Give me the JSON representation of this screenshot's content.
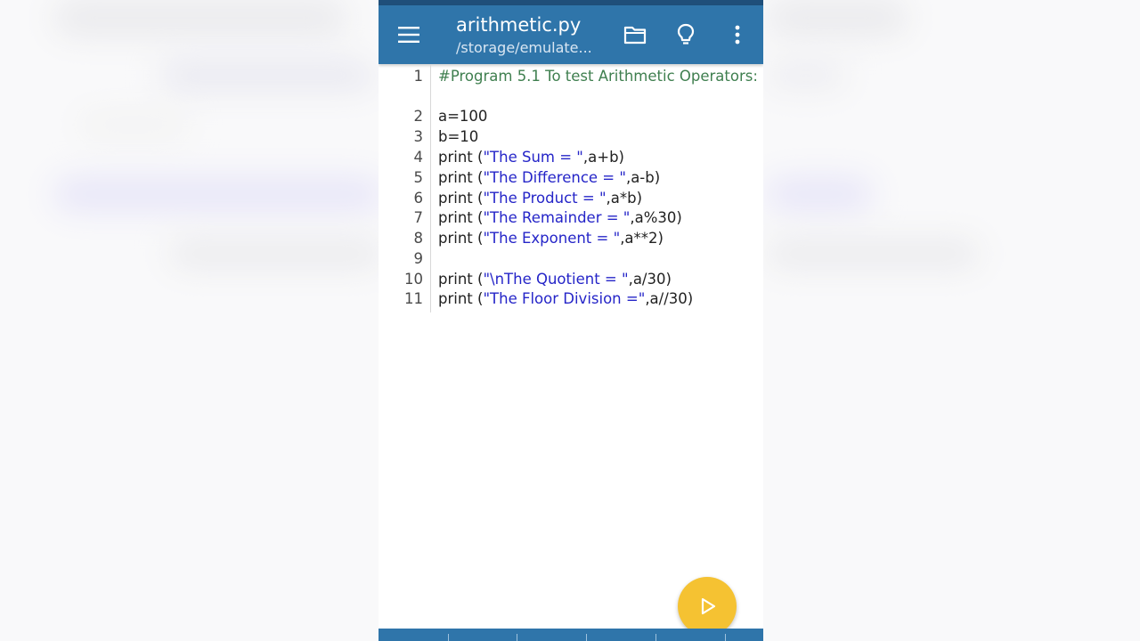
{
  "header": {
    "title": "arithmetic.py",
    "subtitle": "/storage/emulate..."
  },
  "icons": {
    "menu": "menu-icon",
    "folder": "folder-icon",
    "bulb": "lightbulb-icon",
    "more": "more-vert-icon",
    "run": "play-icon"
  },
  "colors": {
    "appbar": "#2f75aa",
    "comment": "#3f7f4f",
    "string": "#2525c8",
    "fab": "#f5c232"
  },
  "editor": {
    "lines": [
      {
        "num": "1",
        "parts": [
          {
            "text": "#Program 5.1 To test Arithmetic Operators:",
            "cls": "comment"
          }
        ]
      },
      {
        "num": "2",
        "parts": [
          {
            "text": "a=100",
            "cls": ""
          }
        ]
      },
      {
        "num": "3",
        "parts": [
          {
            "text": "b=10",
            "cls": ""
          }
        ]
      },
      {
        "num": "4",
        "parts": [
          {
            "text": "print (",
            "cls": ""
          },
          {
            "text": "\"The Sum = \"",
            "cls": "str"
          },
          {
            "text": ",a+b)",
            "cls": ""
          }
        ]
      },
      {
        "num": "5",
        "parts": [
          {
            "text": "print (",
            "cls": ""
          },
          {
            "text": "\"The Difference = \"",
            "cls": "str"
          },
          {
            "text": ",a-b)",
            "cls": ""
          }
        ]
      },
      {
        "num": "6",
        "parts": [
          {
            "text": "print (",
            "cls": ""
          },
          {
            "text": "\"The Product = \"",
            "cls": "str"
          },
          {
            "text": ",a*b)",
            "cls": ""
          }
        ]
      },
      {
        "num": "7",
        "parts": [
          {
            "text": "print (",
            "cls": ""
          },
          {
            "text": "\"The Remainder = \"",
            "cls": "str"
          },
          {
            "text": ",a%30)",
            "cls": ""
          }
        ]
      },
      {
        "num": "8",
        "parts": [
          {
            "text": "print (",
            "cls": ""
          },
          {
            "text": "\"The Exponent = \"",
            "cls": "str"
          },
          {
            "text": ",a**2)",
            "cls": ""
          }
        ]
      },
      {
        "num": "9",
        "parts": []
      },
      {
        "num": "10",
        "parts": [
          {
            "text": "print (",
            "cls": ""
          },
          {
            "text": "\"\\nThe Quotient = \"",
            "cls": "str"
          },
          {
            "text": ",a/30)",
            "cls": ""
          }
        ]
      },
      {
        "num": "11",
        "parts": [
          {
            "text": "print (",
            "cls": ""
          },
          {
            "text": "\"The Floor Division =\"",
            "cls": "str"
          },
          {
            "text": ",a//30)",
            "cls": ""
          }
        ]
      }
    ]
  }
}
